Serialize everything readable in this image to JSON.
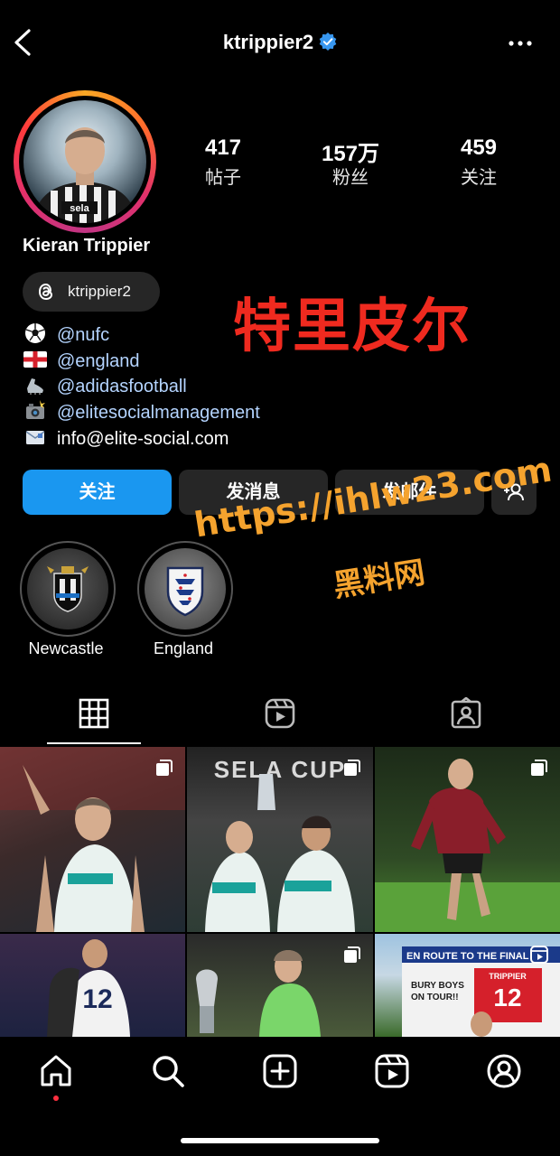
{
  "header": {
    "username": "ktrippier2"
  },
  "profile": {
    "name": "Kieran Trippier",
    "threads_handle": "ktrippier2",
    "stats": [
      {
        "value": "417",
        "label": "帖子"
      },
      {
        "value": "157万",
        "label": "粉丝"
      },
      {
        "value": "459",
        "label": "关注"
      }
    ],
    "bio": [
      {
        "icon": "soccer-ball-icon",
        "text": "@nufc",
        "is_link": true
      },
      {
        "icon": "england-flag-icon",
        "text": "@england",
        "is_link": true
      },
      {
        "icon": "football-boot-icon",
        "text": "@adidasfootball",
        "is_link": true
      },
      {
        "icon": "camera-flash-icon",
        "text": "@elitesocialmanagement",
        "is_link": true
      },
      {
        "icon": "email-icon",
        "text": "info@elite-social.com",
        "is_link": false
      }
    ]
  },
  "actions": {
    "follow": "关注",
    "message": "发消息",
    "email": "发邮件"
  },
  "highlights": [
    {
      "label": "Newcastle"
    },
    {
      "label": "England"
    }
  ],
  "overlays": {
    "name_cn": "特里皮尔",
    "url": "https://ihlw23.com",
    "site_cn": "黑料网"
  },
  "grid_posts": [
    {
      "kind": "carousel",
      "text": ""
    },
    {
      "kind": "carousel",
      "text": "SELA CUP"
    },
    {
      "kind": "carousel",
      "text": ""
    },
    {
      "kind": "photo",
      "text": "12"
    },
    {
      "kind": "carousel",
      "text": ""
    },
    {
      "kind": "reel",
      "text": "EN ROUTE TO THE FINAL · BURY BOYS ON TOUR!! · TRIPPIER 12"
    }
  ],
  "colors": {
    "accent": "#1a97f0",
    "link": "#b4d4ff",
    "watermark_red": "#ef2a1f",
    "watermark_orange": "#f5a32e"
  },
  "icons": {
    "header": [
      "back-arrow-icon",
      "verified-badge-icon",
      "more-options-icon"
    ],
    "tabs": [
      "grid-tab-icon",
      "reels-tab-icon",
      "tagged-tab-icon"
    ],
    "nav": [
      "home-icon",
      "search-icon",
      "create-post-icon",
      "reels-icon",
      "profile-icon"
    ]
  }
}
